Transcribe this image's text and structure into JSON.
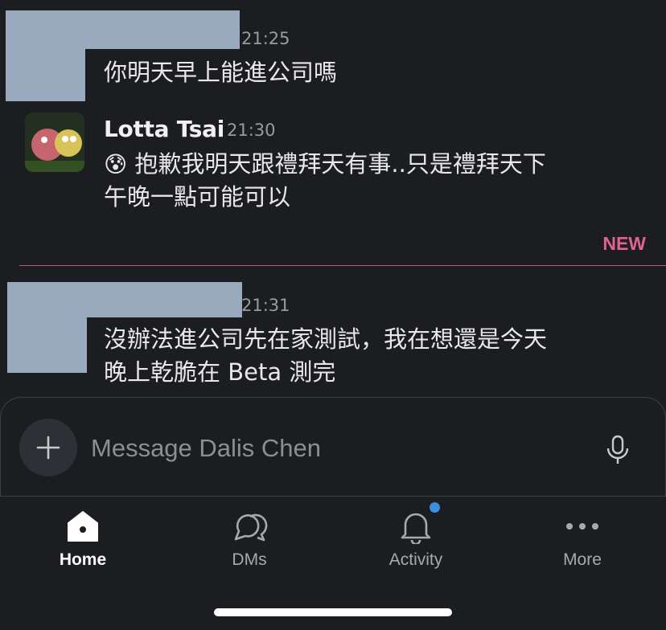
{
  "messages": [
    {
      "time": "21:25",
      "text": "你明天早上能進公司嗎"
    },
    {
      "author": "Lotta Tsai",
      "time": "21:30",
      "emoji": "😰",
      "text_line1": "抱歉我明天跟禮拜天有事..只是禮拜天下",
      "text_line2": "午晚一點可能可以"
    },
    {
      "time": "21:31",
      "text_line1": "沒辦法進公司先在家測試，我在想還是今天",
      "text_line2": "晚上乾脆在 Beta 測完"
    }
  ],
  "divider": {
    "label": "NEW"
  },
  "composer": {
    "placeholder": "Message Dalis Chen"
  },
  "tabs": [
    {
      "label": "Home",
      "icon": "home-icon",
      "active": true
    },
    {
      "label": "DMs",
      "icon": "dms-icon"
    },
    {
      "label": "Activity",
      "icon": "bell-icon",
      "unread_dot": true
    },
    {
      "label": "More",
      "icon": "more-dots-icon"
    }
  ],
  "colors": {
    "background": "#1b1d21",
    "new_divider": "#e0638c",
    "unread_dot": "#3c8ee0"
  }
}
